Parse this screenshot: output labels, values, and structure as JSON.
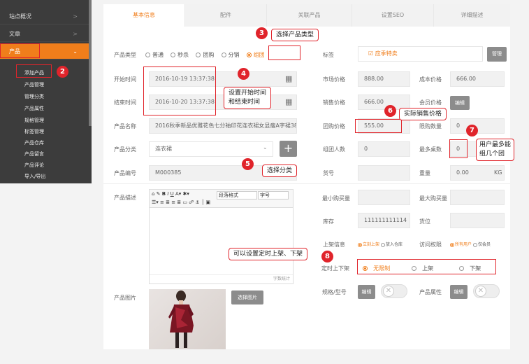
{
  "sidebar": {
    "items": [
      {
        "label": "站点概况"
      },
      {
        "label": "文章"
      },
      {
        "label": "产品"
      }
    ],
    "subitems": [
      "添加产品",
      "产品管理",
      "管理分类",
      "产品属性",
      "规格管理",
      "标签管理",
      "产品仓库",
      "产品留言",
      "产品评论",
      "导入/导出"
    ],
    "chevron_right": ">",
    "chevron_down": "⌄"
  },
  "tabs": [
    "基本信息",
    "配件",
    "关联产品",
    "设置SEO",
    "详细描述"
  ],
  "form": {
    "type_label": "产品类型",
    "type_options": [
      "普通",
      "秒杀",
      "团购",
      "分销",
      "组团"
    ],
    "start_label": "开始时间",
    "start_value": "2016-10-19 13:37:38",
    "end_label": "结束时间",
    "end_value": "2016-10-20 13:37:38",
    "name_label": "产品名称",
    "name_value": "2016秋季新品优雅花色七分袖印花连衣裙女显瘦A字裙3862",
    "category_label": "产品分类",
    "category_value": "连衣裙",
    "add_symbol": "+",
    "code_label": "产品编号",
    "code_value": "M000385",
    "desc_label": "产品描述",
    "word_count": "字数统计",
    "editor_format": "段落格式",
    "editor_size": "字号",
    "image_label": "产品图片",
    "image_button": "选择图片",
    "tag_label": "标签",
    "tag_value": "应季特卖",
    "tag_button": "管理",
    "market_label": "市场价格",
    "market_value": "888.00",
    "cost_label": "成本价格",
    "cost_value": "666.00",
    "sale_label": "销售价格",
    "sale_value": "666.00",
    "member_label": "会员价格",
    "member_button": "编辑",
    "group_label": "团购价格",
    "group_value": "555.00",
    "limit_label": "限购数量",
    "limit_value": "0",
    "team_label": "组团人数",
    "team_value": "0",
    "maxteam_label": "最多桌数",
    "maxteam_value": "0",
    "goods_label": "货号",
    "weight_label": "重量",
    "weight_value": "0.00",
    "weight_unit": "KG",
    "minbuy_label": "最小购买量",
    "maxbuy_label": "最大购买量",
    "stock_label": "库存",
    "stock_value": "111111111114",
    "pos_label": "货位",
    "shelf_label": "上架信息",
    "shelf_opts": [
      "立刻上架",
      "放入仓库"
    ],
    "access_label": "访问权限",
    "access_opts": [
      "所有用户",
      "仅会员"
    ],
    "timed_label": "定时上下架",
    "timed_opts": [
      "无限制",
      "上架",
      "下架"
    ],
    "spec_label": "规格/型号",
    "spec_button": "编辑",
    "attr_label": "产品属性",
    "attr_button": "编辑",
    "toggle_x": "✕"
  },
  "annotations": {
    "n2": "2",
    "n3": "3",
    "t3": "选择产品类型",
    "n4": "4",
    "t4a": "设置开始时间",
    "t4b": "和结束时间",
    "n5": "5",
    "t5": "选择分类",
    "n6": "6",
    "t6": "实际销售价格",
    "n7": "7",
    "t7a": "用户最多能",
    "t7b": "组几个团",
    "n8": "8",
    "t8": "可以设置定时上架、下架"
  },
  "colors": {
    "accent": "#f07e1b",
    "annotation": "#e0242b"
  }
}
